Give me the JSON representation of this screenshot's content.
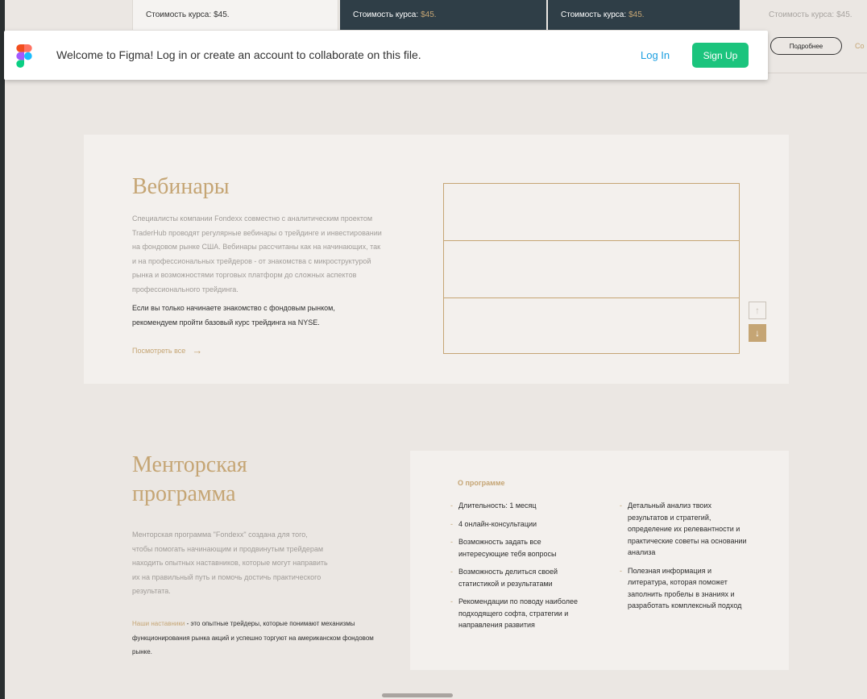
{
  "courses": [
    {
      "label": "Стоимость курса:",
      "price": "$45."
    },
    {
      "label": "Стоимость курса:",
      "price": "$45."
    },
    {
      "label": "Стоимость курса:",
      "price": "$45."
    },
    {
      "label": "Стоимость курса:",
      "price": "$45."
    }
  ],
  "more_button": "Подробнее",
  "more_link_partial": "Со",
  "banner": {
    "text": "Welcome to Figma! Log in or create an account to collaborate on this file.",
    "login": "Log In",
    "signup": "Sign Up"
  },
  "webinars": {
    "title": "Вебинары",
    "description": "Специалисты компании Fondexx совместно с аналитическим проектом TraderHub проводят регулярные вебинары о трейдинге и инвестировании на фондовом рынке США. Вебинары рассчитаны как на начинающих, так и на профессиональных трейдеров - от знакомства с микроструктурой рынка и возможностями торговых платформ до сложных аспектов профессионального трейдинга.",
    "recommendation": "Если вы только начинаете знакомство с фондовым рынком, рекомендуем пройти базовый курс трейдинга на NYSE.",
    "see_all": "Посмотреть все",
    "see_all_arrow": "→",
    "up_arrow": "↑",
    "down_arrow": "↓"
  },
  "mentor": {
    "title": "Менторская программа",
    "description": "Менторская программа \"Fondexx\" создана для того, чтобы помогать начинающим и продвинутым трейдерам находить опытных наставников, которые могут направить их на правильный путь и помочь достичь практического результата.",
    "note_highlight": "Наши наставники",
    "note_rest": " - это опытные трейдеры, которые понимают механизмы функционирования рынка акций и успешно торгуют на американском фондовом рынке.",
    "program_heading": "О программе",
    "left_items": [
      "Длительность: 1 месяц",
      "4 онлайн-консультации",
      "Возможность задать все интересующие тебя вопросы",
      "Возможность делиться своей статистикой и результатами",
      "Рекомендации по поводу наиболее подходящего софта, стратегии и направления развития"
    ],
    "right_items": [
      "Детальный анализ твоих результатов и стратегий, определение их релевантности и практические советы на основании анализа",
      "Полезная информация и литература, которая поможет заполнить пробелы в знаниях и разработать комплексный подход"
    ]
  },
  "colors": {
    "accent_gold": "#c5a574",
    "figma_green": "#1bc47d",
    "figma_blue": "#1a9ee0",
    "dark_card": "#2f3e47"
  },
  "icons": {
    "figma_logo": "figma-logo-icon",
    "arrow_right": "arrow-right-icon",
    "arrow_up": "arrow-up-icon",
    "arrow_down": "arrow-down-icon"
  }
}
